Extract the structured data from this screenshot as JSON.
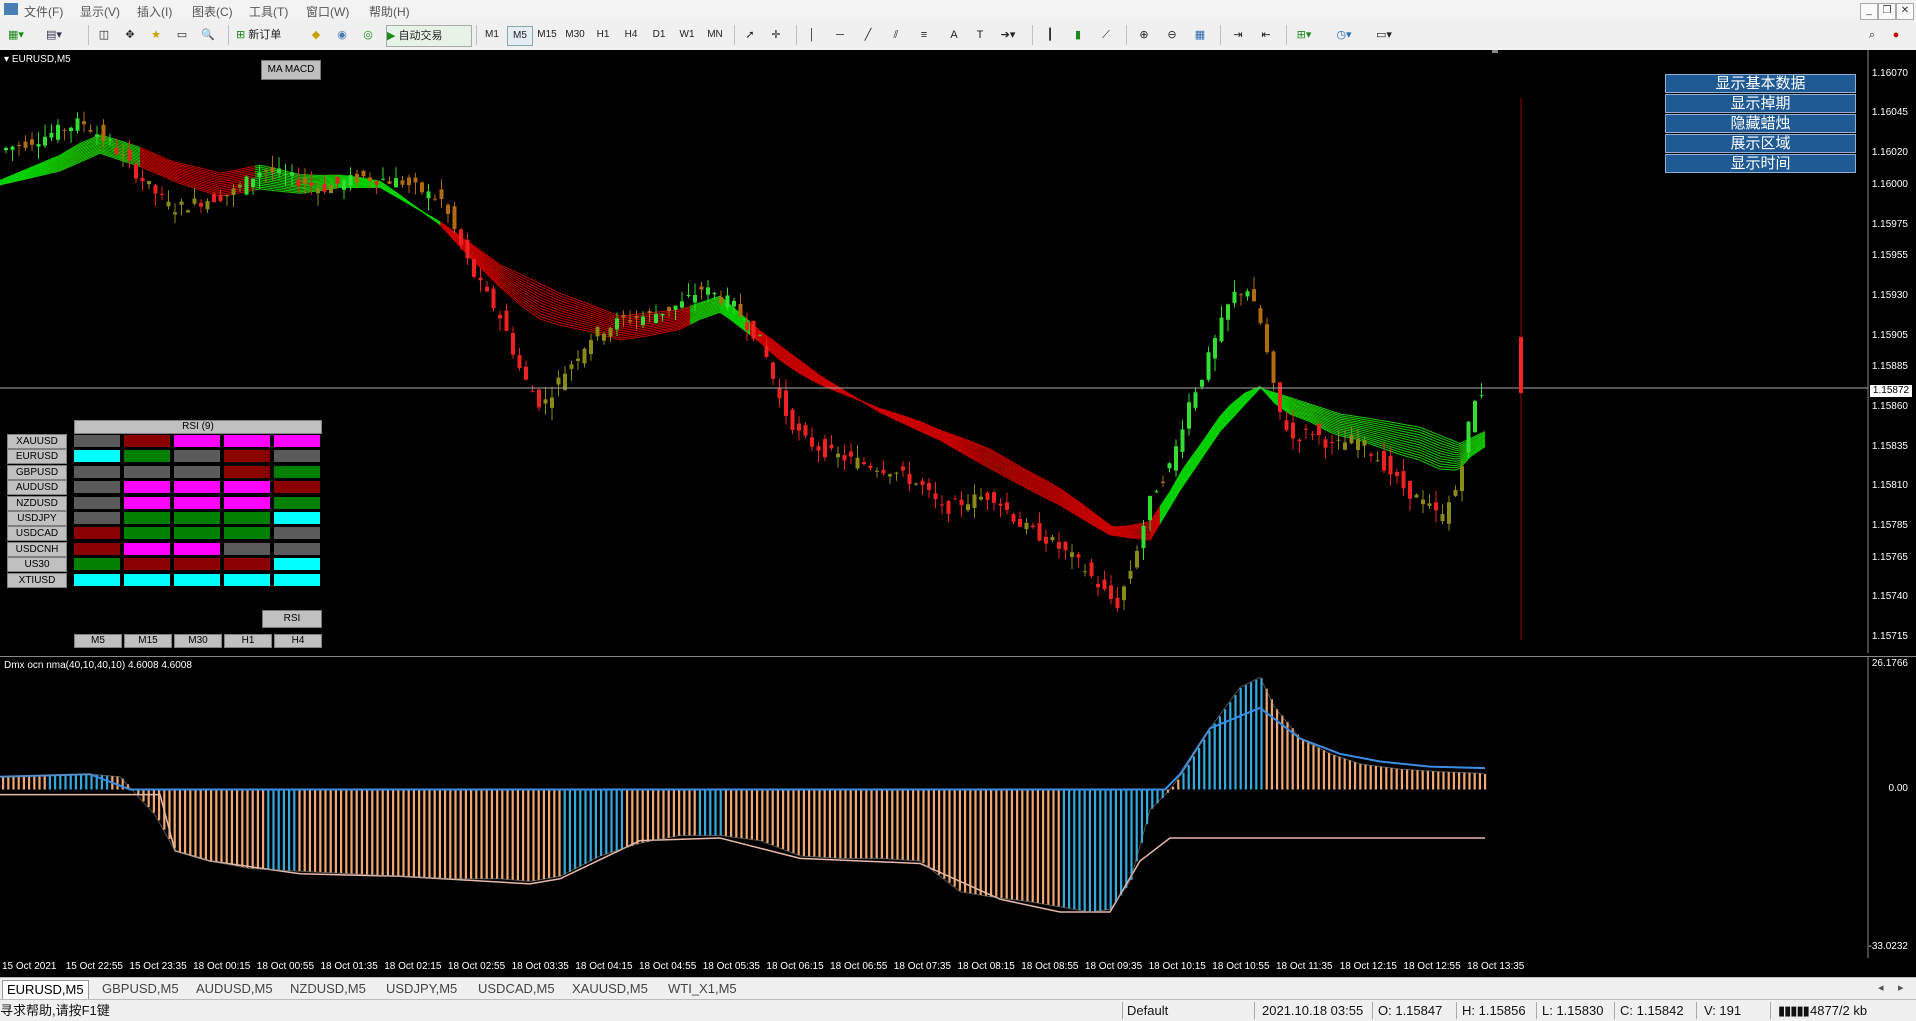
{
  "menu": [
    "文件(F)",
    "显示(V)",
    "插入(I)",
    "图表(C)",
    "工具(T)",
    "窗口(W)",
    "帮助(H)"
  ],
  "toolbar": {
    "new_order": "新订单",
    "auto_trade": "自动交易",
    "timeframes": [
      "M1",
      "M5",
      "M15",
      "M30",
      "H1",
      "H4",
      "D1",
      "W1",
      "MN"
    ],
    "selected_tf": "M5"
  },
  "chart": {
    "symbol_label": "EURUSD,M5",
    "ma_macd_button": "MA MACD",
    "price_labels": [
      "1.16070",
      "1.16045",
      "1.16020",
      "1.16000",
      "1.15975",
      "1.15955",
      "1.15930",
      "1.15905",
      "1.15885",
      "1.15860",
      "1.15835",
      "1.15810",
      "1.15785",
      "1.15765",
      "1.15740",
      "1.15715"
    ],
    "current_price": "1.15872",
    "right_buttons": [
      "显示基本数据",
      "显示掉期",
      "隐藏蜡烛",
      "展示区域",
      "显示时间"
    ]
  },
  "rsi_panel": {
    "title": "RSI (9)",
    "symbols": [
      "XAUUSD",
      "EURUSD",
      "GBPUSD",
      "AUDUSD",
      "NZDUSD",
      "USDJPY",
      "USDCAD",
      "USDCNH",
      "US30",
      "XTIUSD"
    ],
    "timeframes": [
      "M5",
      "M15",
      "M30",
      "H1",
      "H4"
    ],
    "button": "RSI",
    "colors": {
      "gray": "#5a5a5a",
      "darkred": "#8b0000",
      "magenta": "#ff00ff",
      "cyan": "#00ffff",
      "green": "#008000"
    },
    "grid": [
      [
        "gray",
        "darkred",
        "magenta",
        "magenta",
        "magenta"
      ],
      [
        "cyan",
        "green",
        "gray",
        "darkred",
        "gray"
      ],
      [
        "gray",
        "gray",
        "gray",
        "darkred",
        "green"
      ],
      [
        "gray",
        "magenta",
        "magenta",
        "magenta",
        "darkred"
      ],
      [
        "gray",
        "magenta",
        "magenta",
        "magenta",
        "green"
      ],
      [
        "gray",
        "green",
        "green",
        "green",
        "cyan"
      ],
      [
        "darkred",
        "green",
        "green",
        "green",
        "gray"
      ],
      [
        "darkred",
        "magenta",
        "magenta",
        "gray",
        "gray"
      ],
      [
        "green",
        "darkred",
        "darkred",
        "darkred",
        "cyan"
      ],
      [
        "cyan",
        "cyan",
        "cyan",
        "cyan",
        "cyan"
      ]
    ]
  },
  "indicator": {
    "label": "Dmx ocn nma(40,10,40,10) 4.6008 4.6008",
    "max_label": "26.1766",
    "zero_label": "0.00",
    "min_label": "-33.0232"
  },
  "time_labels": [
    "15 Oct 2021",
    "15 Oct 22:55",
    "15 Oct 23:35",
    "18 Oct 00:15",
    "18 Oct 00:55",
    "18 Oct 01:35",
    "18 Oct 02:15",
    "18 Oct 02:55",
    "18 Oct 03:35",
    "18 Oct 04:15",
    "18 Oct 04:55",
    "18 Oct 05:35",
    "18 Oct 06:15",
    "18 Oct 06:55",
    "18 Oct 07:35",
    "18 Oct 08:15",
    "18 Oct 08:55",
    "18 Oct 09:35",
    "18 Oct 10:15",
    "18 Oct 10:55",
    "18 Oct 11:35",
    "18 Oct 12:15",
    "18 Oct 12:55",
    "18 Oct 13:35"
  ],
  "tabs": [
    "EURUSD,M5",
    "GBPUSD,M5",
    "AUDUSD,M5",
    "NZDUSD,M5",
    "USDJPY,M5",
    "USDCAD,M5",
    "XAUUSD,M5",
    "WTI_X1,M5"
  ],
  "active_tab": "EURUSD,M5",
  "status": {
    "help": "寻求帮助,请按F1键",
    "profile": "Default",
    "datetime": "2021.10.18 03:55",
    "open": "O: 1.15847",
    "high": "H: 1.15856",
    "low": "L: 1.15830",
    "close": "C: 1.15842",
    "volume": "V: 191",
    "traffic": "4877/2 kb"
  },
  "series": {
    "price_path": [
      [
        0,
        1.16022
      ],
      [
        40,
        1.1603
      ],
      [
        80,
        1.1604
      ],
      [
        110,
        1.16025
      ],
      [
        145,
        1.16
      ],
      [
        170,
        1.15985
      ],
      [
        200,
        1.1599
      ],
      [
        230,
        1.15995
      ],
      [
        260,
        1.1601
      ],
      [
        285,
        1.16005
      ],
      [
        320,
        1.15998
      ],
      [
        360,
        1.16005
      ],
      [
        400,
        1.16002
      ],
      [
        440,
        1.1599
      ],
      [
        470,
        1.15945
      ],
      [
        500,
        1.15915
      ],
      [
        520,
        1.1588
      ],
      [
        540,
        1.1586
      ],
      [
        560,
        1.1588
      ],
      [
        590,
        1.15905
      ],
      [
        620,
        1.15915
      ],
      [
        650,
        1.15918
      ],
      [
        680,
        1.15925
      ],
      [
        700,
        1.15935
      ],
      [
        730,
        1.15925
      ],
      [
        760,
        1.159
      ],
      [
        780,
        1.1586
      ],
      [
        800,
        1.1584
      ],
      [
        830,
        1.1583
      ],
      [
        860,
        1.15825
      ],
      [
        890,
        1.1582
      ],
      [
        920,
        1.1581
      ],
      [
        940,
        1.15795
      ],
      [
        960,
        1.158
      ],
      [
        990,
        1.15805
      ],
      [
        1020,
        1.15785
      ],
      [
        1050,
        1.15775
      ],
      [
        1080,
        1.1576
      ],
      [
        1100,
        1.15745
      ],
      [
        1115,
        1.15735
      ],
      [
        1130,
        1.1576
      ],
      [
        1150,
        1.15805
      ],
      [
        1170,
        1.15825
      ],
      [
        1185,
        1.1586
      ],
      [
        1200,
        1.1588
      ],
      [
        1215,
        1.15905
      ],
      [
        1230,
        1.1593
      ],
      [
        1245,
        1.15935
      ],
      [
        1260,
        1.1591
      ],
      [
        1275,
        1.1586
      ],
      [
        1290,
        1.1584
      ],
      [
        1310,
        1.15845
      ],
      [
        1330,
        1.15835
      ],
      [
        1355,
        1.1584
      ],
      [
        1380,
        1.15825
      ],
      [
        1400,
        1.1581
      ],
      [
        1420,
        1.158
      ],
      [
        1440,
        1.1579
      ],
      [
        1455,
        1.1581
      ],
      [
        1470,
        1.1586
      ],
      [
        1485,
        1.15875
      ]
    ],
    "ribbon_path": [
      [
        0,
        1.16
      ],
      [
        60,
        1.16012
      ],
      [
        100,
        1.16025
      ],
      [
        140,
        1.16018
      ],
      [
        180,
        1.16008
      ],
      [
        220,
        1.16
      ],
      [
        260,
        1.16004
      ],
      [
        300,
        1.16
      ],
      [
        340,
        1.16002
      ],
      [
        380,
        1.16
      ],
      [
        440,
        1.15975
      ],
      [
        500,
        1.15945
      ],
      [
        560,
        1.15925
      ],
      [
        620,
        1.1591
      ],
      [
        680,
        1.15915
      ],
      [
        720,
        1.15925
      ],
      [
        760,
        1.15905
      ],
      [
        820,
        1.1588
      ],
      [
        880,
        1.1586
      ],
      [
        940,
        1.15845
      ],
      [
        1000,
        1.15825
      ],
      [
        1060,
        1.15805
      ],
      [
        1110,
        1.15785
      ],
      [
        1150,
        1.1578
      ],
      [
        1180,
        1.1581
      ],
      [
        1220,
        1.15845
      ],
      [
        1260,
        1.1587
      ],
      [
        1300,
        1.1586
      ],
      [
        1340,
        1.1585
      ],
      [
        1380,
        1.15845
      ],
      [
        1420,
        1.1584
      ],
      [
        1460,
        1.1583
      ],
      [
        1485,
        1.15838
      ]
    ],
    "osc_path": [
      [
        0,
        2.5
      ],
      [
        50,
        2.8
      ],
      [
        90,
        3.0
      ],
      [
        120,
        2.5
      ],
      [
        155,
        -5
      ],
      [
        175,
        -12
      ],
      [
        210,
        -14
      ],
      [
        250,
        -15.5
      ],
      [
        300,
        -16
      ],
      [
        350,
        -16.5
      ],
      [
        400,
        -17
      ],
      [
        450,
        -17.5
      ],
      [
        500,
        -17.5
      ],
      [
        530,
        -18
      ],
      [
        560,
        -17
      ],
      [
        600,
        -13
      ],
      [
        640,
        -10.5
      ],
      [
        680,
        -9
      ],
      [
        720,
        -9
      ],
      [
        760,
        -10
      ],
      [
        800,
        -13
      ],
      [
        840,
        -13.5
      ],
      [
        880,
        -13.5
      ],
      [
        920,
        -14
      ],
      [
        960,
        -20
      ],
      [
        990,
        -21
      ],
      [
        1030,
        -22
      ],
      [
        1060,
        -23
      ],
      [
        1090,
        -24
      ],
      [
        1110,
        -23.5
      ],
      [
        1130,
        -18
      ],
      [
        1150,
        -4
      ],
      [
        1170,
        0
      ],
      [
        1185,
        4
      ],
      [
        1210,
        12
      ],
      [
        1240,
        20
      ],
      [
        1260,
        22
      ],
      [
        1275,
        16
      ],
      [
        1300,
        10
      ],
      [
        1330,
        7
      ],
      [
        1360,
        5
      ],
      [
        1400,
        4
      ],
      [
        1440,
        3.5
      ],
      [
        1480,
        3.2
      ],
      [
        1485,
        3.0
      ]
    ],
    "signal_path": [
      [
        0,
        2.5
      ],
      [
        90,
        3.0
      ],
      [
        130,
        0
      ],
      [
        1165,
        0
      ],
      [
        1180,
        3
      ],
      [
        1210,
        12
      ],
      [
        1260,
        16
      ],
      [
        1300,
        10
      ],
      [
        1340,
        7
      ],
      [
        1380,
        5.5
      ],
      [
        1430,
        4.5
      ],
      [
        1485,
        4.2
      ]
    ],
    "lower_env_path": [
      [
        0,
        -1.0
      ],
      [
        160,
        -1.0
      ],
      [
        175,
        -12
      ],
      [
        210,
        -14
      ],
      [
        300,
        -16.5
      ],
      [
        400,
        -17
      ],
      [
        530,
        -18.5
      ],
      [
        560,
        -17.5
      ],
      [
        640,
        -10
      ],
      [
        720,
        -9.5
      ],
      [
        800,
        -13.5
      ],
      [
        920,
        -14.5
      ],
      [
        1000,
        -21.5
      ],
      [
        1060,
        -24
      ],
      [
        1110,
        -24
      ],
      [
        1140,
        -14
      ],
      [
        1170,
        -9.5
      ],
      [
        1485,
        -9.5
      ]
    ],
    "blue_segments": [
      [
        45,
        110
      ],
      [
        265,
        295
      ],
      [
        560,
        625
      ],
      [
        695,
        720
      ],
      [
        1060,
        1165
      ],
      [
        1180,
        1265
      ]
    ]
  }
}
